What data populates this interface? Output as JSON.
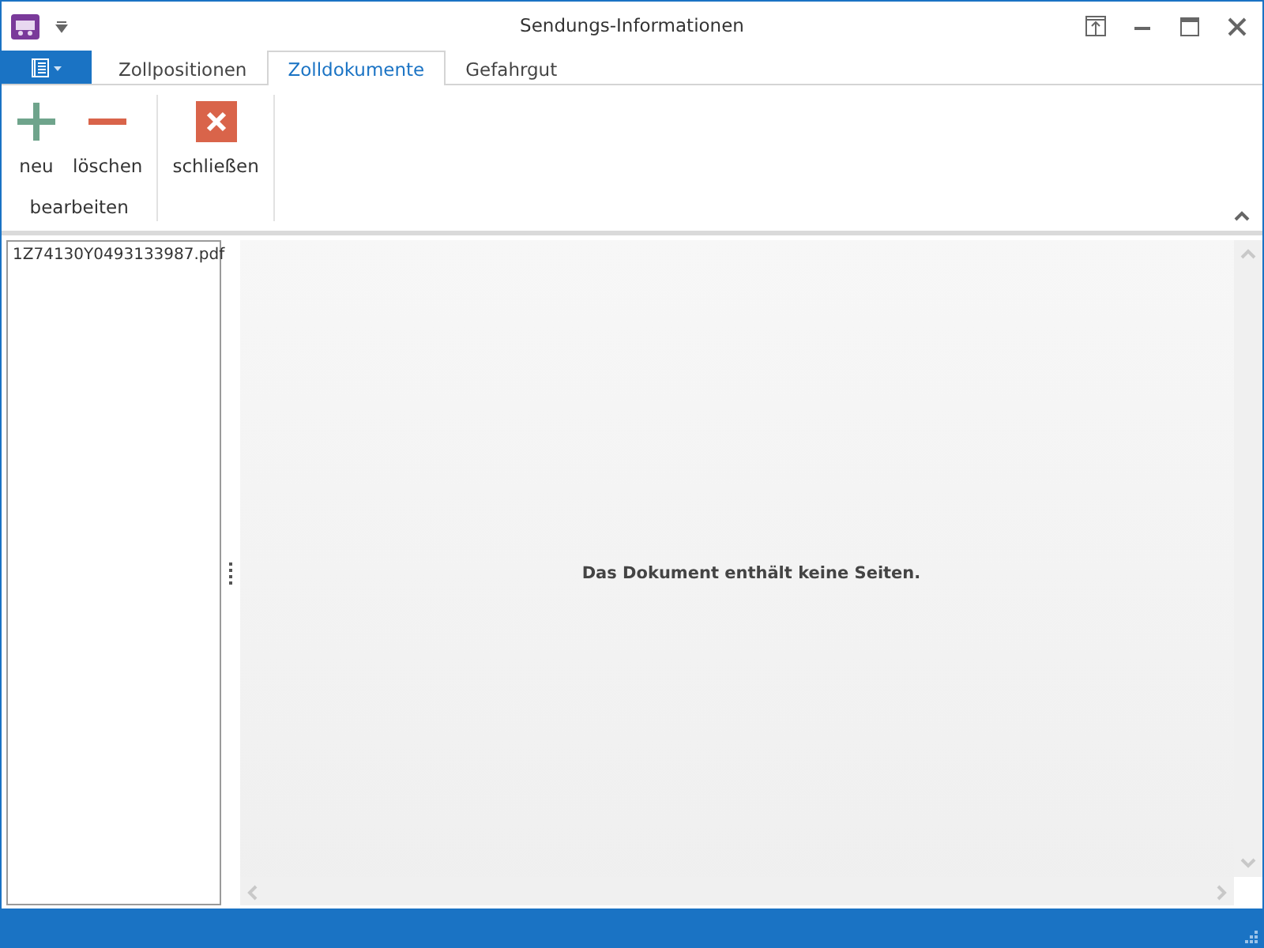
{
  "window": {
    "title": "Sendungs-Informationen"
  },
  "tabs": [
    {
      "label": "Zollpositionen",
      "selected": false
    },
    {
      "label": "Zolldokumente",
      "selected": true
    },
    {
      "label": "Gefahrgut",
      "selected": false
    }
  ],
  "ribbon": {
    "groups": [
      {
        "label": "bearbeiten",
        "buttons": [
          {
            "kind": "add",
            "label": "neu"
          },
          {
            "kind": "remove",
            "label": "löschen"
          }
        ]
      },
      {
        "buttons": [
          {
            "kind": "close",
            "label": "schließen"
          }
        ]
      }
    ]
  },
  "documents": [
    {
      "name": "1Z74130Y0493133987.pdf"
    }
  ],
  "viewer": {
    "message": "Das Dokument enthält keine Seiten."
  }
}
